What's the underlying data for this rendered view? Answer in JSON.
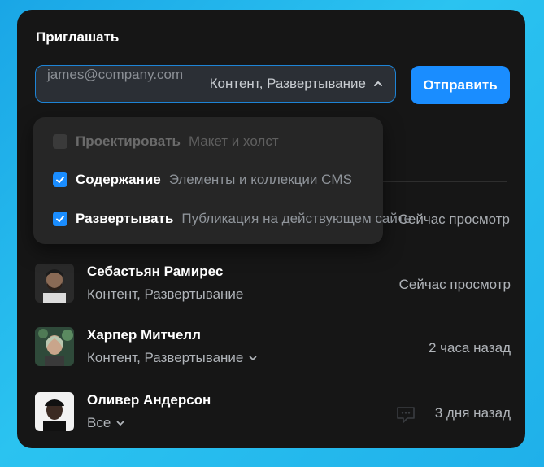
{
  "invite": {
    "title": "Приглашать",
    "email": "james@company.com",
    "permissions_summary": "Контент, Развертывание",
    "send_label": "Отправить"
  },
  "permission_menu": {
    "items": [
      {
        "label": "Проектировать",
        "description": "Макет и холст",
        "checked": false
      },
      {
        "label": "Содержание",
        "description": "Элементы и коллекции CMS",
        "checked": true
      },
      {
        "label": "Развертывать",
        "description": "Публикация на действующем сайте",
        "checked": true
      }
    ]
  },
  "hidden_row_status": "Сейчас просмотр",
  "users": [
    {
      "name": "Себастьян Рамирес",
      "permissions": "Контент, Развертывание",
      "status": "Сейчас просмотр",
      "avatar": "avatar-sebastian"
    },
    {
      "name": "Харпер Митчелл",
      "permissions": "Контент, Развертывание",
      "status": "2 часа назад",
      "avatar": "avatar-harper"
    },
    {
      "name": "Оливер Андерсон",
      "permissions": "Все",
      "status": "3 дня назад",
      "avatar": "avatar-oliver"
    }
  ],
  "colors": {
    "accent": "#1a8dff",
    "card_bg": "#161616",
    "menu_bg": "#262626",
    "background_gradient": "#2bc3f0"
  },
  "icons": [
    "chevron-up-icon",
    "chevron-down-icon",
    "checkbox-icon",
    "message-icon"
  ]
}
